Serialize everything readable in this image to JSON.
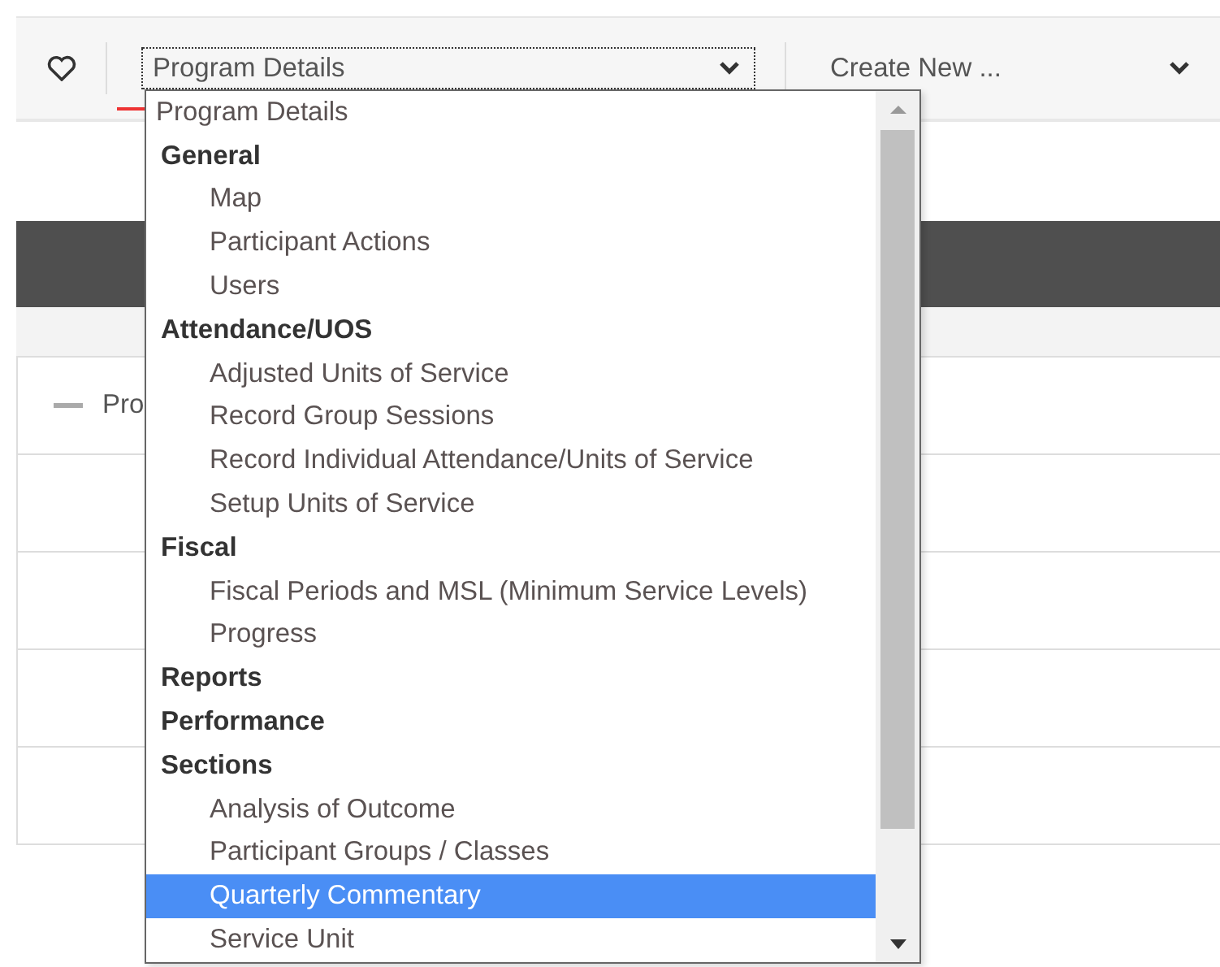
{
  "toolbar": {
    "favorite": {
      "on": false
    },
    "program_select": {
      "value": "Program Details",
      "expanded": true
    },
    "create_select": {
      "value": "Create New ..."
    }
  },
  "dropdown": {
    "options": [
      {
        "label": "Program Details",
        "kind": "option",
        "selected": false
      },
      {
        "label": "General",
        "kind": "group",
        "children": [
          {
            "label": "Map",
            "selected": false
          },
          {
            "label": "Participant Actions",
            "selected": false
          },
          {
            "label": "Users",
            "selected": false
          }
        ]
      },
      {
        "label": "Attendance/UOS",
        "kind": "group",
        "children": [
          {
            "label": "Adjusted Units of Service",
            "selected": false
          },
          {
            "label": "Record Group Sessions",
            "selected": false
          },
          {
            "label": "Record Individual Attendance/Units of Service",
            "selected": false
          },
          {
            "label": "Setup Units of Service",
            "selected": false
          }
        ]
      },
      {
        "label": "Fiscal",
        "kind": "group",
        "children": [
          {
            "label": "Fiscal Periods and MSL (Minimum Service Levels)",
            "selected": false
          },
          {
            "label": "Progress",
            "selected": false
          }
        ]
      },
      {
        "label": "Reports",
        "kind": "group"
      },
      {
        "label": "Performance",
        "kind": "group"
      },
      {
        "label": "Sections",
        "kind": "group",
        "children": [
          {
            "label": "Analysis of Outcome",
            "selected": false
          },
          {
            "label": "Participant Groups / Classes",
            "selected": false
          },
          {
            "label": "Quarterly Commentary",
            "selected": true
          },
          {
            "label": "Service Unit",
            "selected": false
          }
        ]
      }
    ]
  },
  "panel": {
    "header": {
      "label": "Pro",
      "expanded": true
    }
  }
}
